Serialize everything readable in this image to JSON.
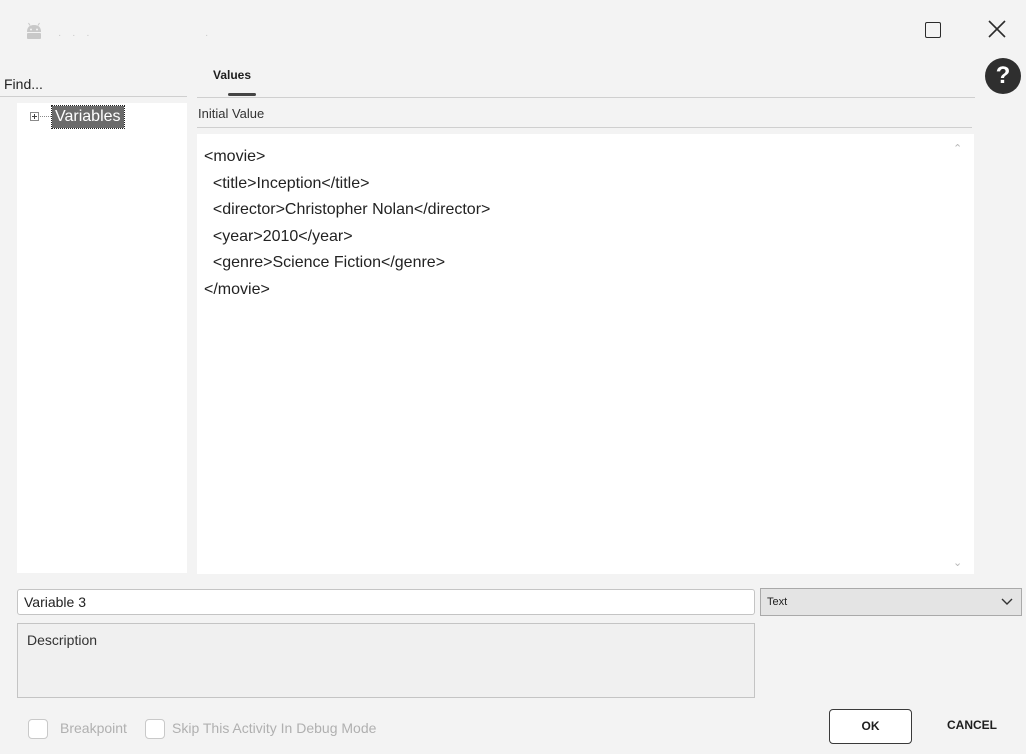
{
  "find": {
    "label": "Find..."
  },
  "tree": {
    "items": [
      {
        "label": "Variables",
        "selected": true
      }
    ]
  },
  "tabs": [
    {
      "label": "Values",
      "active": true
    }
  ],
  "values": {
    "initial_value_label": "Initial Value",
    "initial_value_text": "<movie>\n  <title>Inception</title>\n  <director>Christopher Nolan</director>\n  <year>2010</year>\n  <genre>Science Fiction</genre>\n</movie>"
  },
  "variable": {
    "name_value": "Variable 3",
    "type_selected": "Text",
    "description_placeholder": "Description"
  },
  "footer": {
    "breakpoint_label": "Breakpoint",
    "skip_debug_label": "Skip This Activity In Debug Mode",
    "ok_label": "OK",
    "cancel_label": "CANCEL"
  },
  "icons": {
    "app": "android-robot-icon",
    "maximize": "maximize-icon",
    "close": "close-icon",
    "help": "help-icon",
    "expand": "expand-plus-icon",
    "chevron": "chevron-down-icon"
  },
  "colors": {
    "selection": "#6b6b6b",
    "help_bg": "#2f2f2f"
  }
}
